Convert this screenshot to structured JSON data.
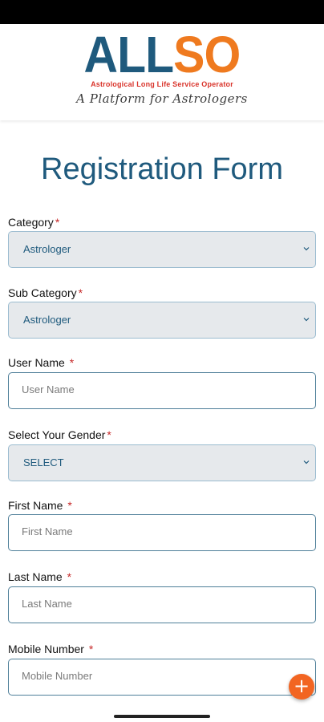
{
  "brand": {
    "logo_part1": "ALL",
    "logo_part2": "SO",
    "tagline": "Astrological Long Life Service Operator",
    "subtitle": "A Platform for Astrologers",
    "colors": {
      "primary": "#1f5a7d",
      "accent": "#ef7a1f",
      "required": "#c62828"
    }
  },
  "page": {
    "title": "Registration Form"
  },
  "form": {
    "category": {
      "label": "Category",
      "required_mark": "*",
      "value": "Astrologer"
    },
    "sub_category": {
      "label": "Sub Category",
      "required_mark": "*",
      "value": "Astrologer"
    },
    "user_name": {
      "label": "User Name",
      "required_mark": "*",
      "placeholder": "User Name"
    },
    "gender": {
      "label": "Select Your Gender",
      "required_mark": "*",
      "value": "SELECT"
    },
    "first_name": {
      "label": "First Name",
      "required_mark": "*",
      "placeholder": "First Name"
    },
    "last_name": {
      "label": "Last Name",
      "required_mark": "*",
      "placeholder": "Last Name"
    },
    "mobile": {
      "label": "Mobile Number",
      "required_mark": "*",
      "placeholder": "Mobile Number"
    }
  },
  "fab": {
    "icon": "plus-icon",
    "symbol": "+"
  }
}
